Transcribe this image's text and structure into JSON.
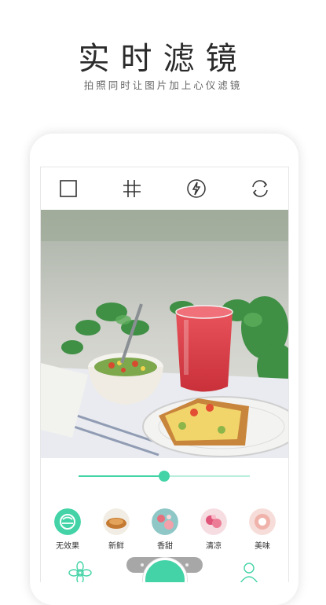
{
  "hero": {
    "title": "实时滤镜",
    "subtitle": "拍照同时让图片加上心仪滤镜"
  },
  "toolbar": {
    "icons": [
      "square-ratio-icon",
      "crop-grid-icon",
      "flash-icon",
      "switch-camera-icon"
    ]
  },
  "slider": {
    "value": 0.5
  },
  "filters": [
    {
      "label": "无效果",
      "selected": true
    },
    {
      "label": "新鲜",
      "selected": false
    },
    {
      "label": "香甜",
      "selected": false
    },
    {
      "label": "清凉",
      "selected": false
    },
    {
      "label": "美味",
      "selected": false
    }
  ],
  "bottom_nav": {
    "icons": [
      "flower-icon",
      "camera-shutter-icon",
      "people-icon"
    ]
  },
  "colors": {
    "accent": "#43d3a6",
    "accent_light": "#b9eddc"
  }
}
